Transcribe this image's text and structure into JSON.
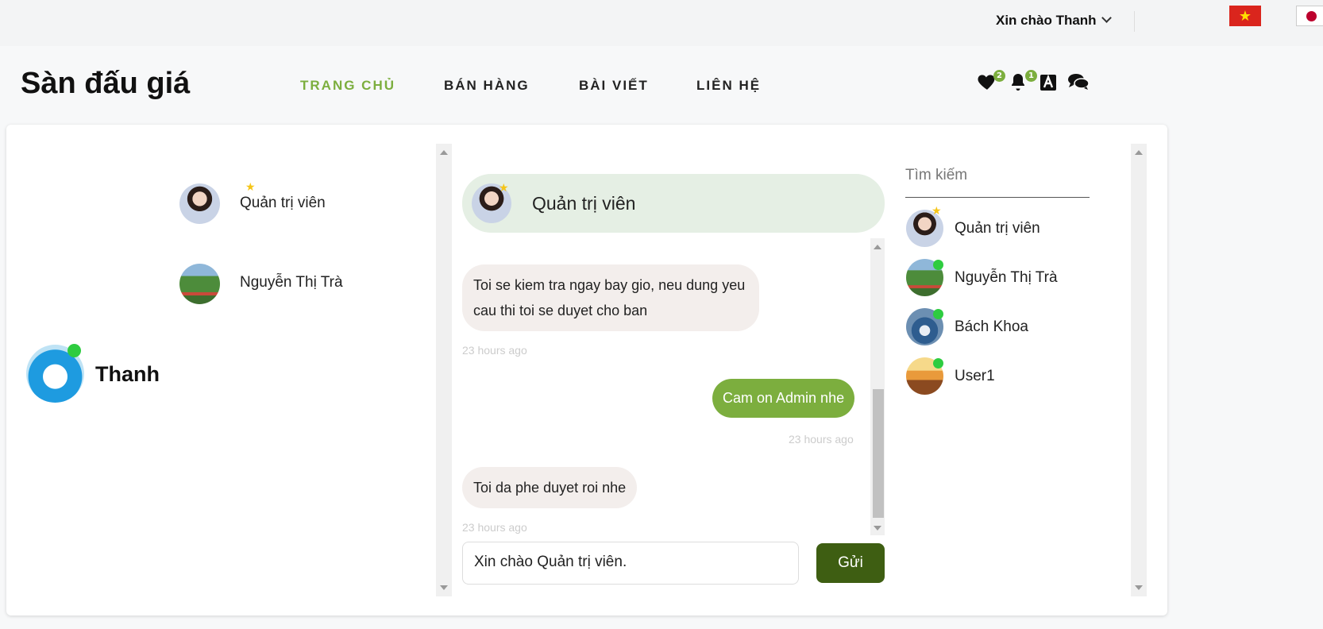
{
  "topbar": {
    "greeting": "Xin chào Thanh",
    "flags": [
      "vietnam-flag",
      "japan-flag"
    ]
  },
  "header": {
    "logo": "Sàn đấu giá",
    "nav": [
      "TRANG CHỦ",
      "BÁN HÀNG",
      "BÀI VIẾT",
      "LIÊN HỆ"
    ],
    "active_nav": "TRANG CHỦ",
    "favorites_count": "2",
    "notifications_count": "1",
    "accent_color": "#7cae3e"
  },
  "left_panel": {
    "contacts": [
      {
        "name": "Quản trị viên",
        "icon": "star-icon"
      },
      {
        "name": "Nguyễn Thị Trà"
      }
    ],
    "me": {
      "name": "Thanh",
      "status": "online"
    }
  },
  "chat": {
    "title": "Quản trị viên",
    "messages": [
      {
        "side": "left",
        "text": "Toi se kiem tra ngay bay gio, neu dung yeu cau thi toi se duyet cho ban",
        "time": "23 hours ago"
      },
      {
        "side": "right",
        "text": "Cam on Admin nhe",
        "time": "23 hours ago"
      },
      {
        "side": "left",
        "text": "Toi da phe duyet roi nhe",
        "time": "23 hours ago"
      }
    ],
    "input_value": "Xin chào Quản trị viên.",
    "send_label": "Gửi",
    "send_color": "#3e5e12"
  },
  "right_panel": {
    "search_placeholder": "Tìm kiếm",
    "users": [
      {
        "name": "Quản trị viên",
        "badge": "star"
      },
      {
        "name": "Nguyễn Thị Trà",
        "badge": "online"
      },
      {
        "name": "Bách Khoa",
        "badge": "online"
      },
      {
        "name": "User1",
        "badge": "online"
      }
    ]
  }
}
